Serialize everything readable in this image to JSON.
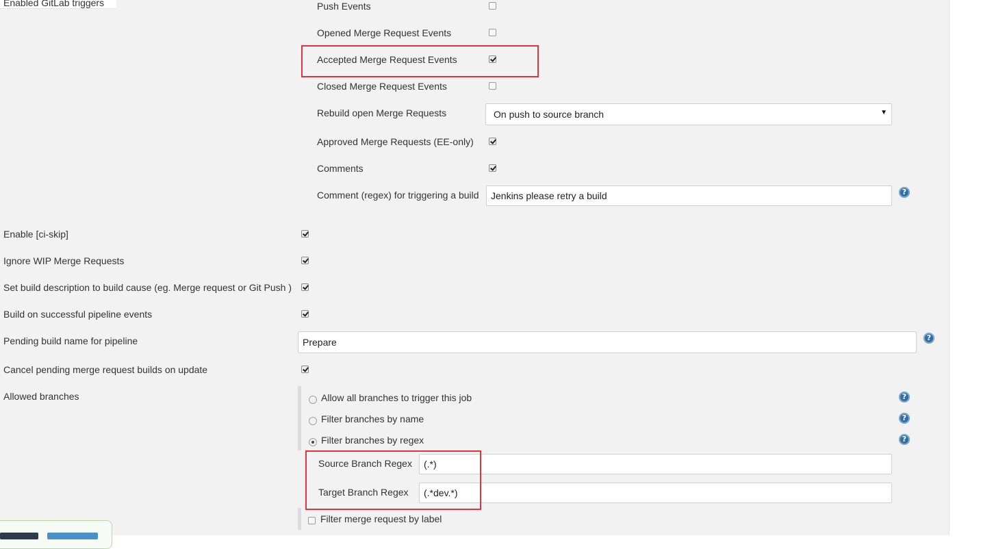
{
  "section_title": "Enabled GitLab triggers",
  "gitlab_triggers": {
    "push_events": {
      "label": "Push Events",
      "checked": false
    },
    "opened_mr_events": {
      "label": "Opened Merge Request Events",
      "checked": false
    },
    "accepted_mr_events": {
      "label": "Accepted Merge Request Events",
      "checked": true
    },
    "closed_mr_events": {
      "label": "Closed Merge Request Events",
      "checked": false
    },
    "rebuild_open_mr": {
      "label": "Rebuild open Merge Requests",
      "selected": "On push to source branch"
    },
    "approved_mr": {
      "label": "Approved Merge Requests (EE-only)",
      "checked": true
    },
    "comments": {
      "label": "Comments",
      "checked": true
    },
    "comment_regex": {
      "label": "Comment (regex) for triggering a build",
      "value": "Jenkins please retry a build"
    }
  },
  "options": {
    "ci_skip": {
      "label": "Enable [ci-skip]",
      "checked": true
    },
    "ignore_wip": {
      "label": "Ignore WIP Merge Requests",
      "checked": true
    },
    "build_description": {
      "label": "Set build description to build cause (eg. Merge request or Git Push )",
      "checked": true
    },
    "pipeline_events": {
      "label": "Build on successful pipeline events",
      "checked": true
    },
    "pending_build_name": {
      "label": "Pending build name for pipeline",
      "value": "Prepare"
    },
    "cancel_pending": {
      "label": "Cancel pending merge request builds on update",
      "checked": true
    }
  },
  "allowed_branches": {
    "label": "Allowed branches",
    "radios": [
      {
        "label": "Allow all branches to trigger this job",
        "checked": false
      },
      {
        "label": "Filter branches by name",
        "checked": false
      },
      {
        "label": "Filter branches by regex",
        "checked": true
      }
    ],
    "source_regex": {
      "label": "Source Branch Regex",
      "value": "(.*)"
    },
    "target_regex": {
      "label": "Target Branch Regex",
      "value": "(.*dev.*)"
    },
    "filter_by_label": {
      "label": "Filter merge request by label",
      "checked": false
    }
  },
  "colors": {
    "panel_bg": "#f2f2f2",
    "highlight": "#e2343b",
    "help_icon": "#2f6fa3"
  },
  "icons": {
    "help": "question-mark-circle-icon",
    "select_arrow": "triangle-down-icon"
  }
}
